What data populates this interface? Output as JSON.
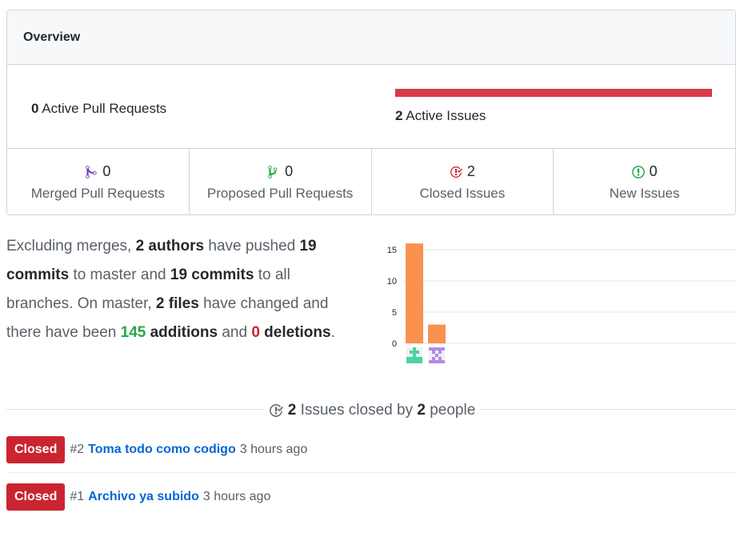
{
  "overview": {
    "title": "Overview"
  },
  "summary": {
    "pull_requests_count": "0",
    "pull_requests_label": "Active Pull Requests",
    "issues_count": "2",
    "issues_label": "Active Issues",
    "issues_bar_fraction": 1.0,
    "issues_bar_color": "#d73a49"
  },
  "stats": [
    {
      "icon": "git-merge-icon",
      "count": "0",
      "label": "Merged Pull Requests",
      "color": "#6f42c1"
    },
    {
      "icon": "git-pull-request-icon",
      "count": "0",
      "label": "Proposed Pull Requests",
      "color": "#28a745"
    },
    {
      "icon": "issue-closed-icon",
      "count": "2",
      "label": "Closed Issues",
      "color": "#cb2431"
    },
    {
      "icon": "issue-opened-icon",
      "count": "0",
      "label": "New Issues",
      "color": "#28a745"
    }
  ],
  "commits_summary": {
    "t1": "Excluding merges, ",
    "authors": "2 authors",
    "t2": " have pushed ",
    "commits_master": "19 commits",
    "t3": " to master and ",
    "commits_all": "19 commits",
    "t4": " to all branches. On master, ",
    "files": "2 files",
    "t5": " have changed and there have been ",
    "additions_num": "145",
    "additions_word": " additions",
    "t6": " and ",
    "deletions_num": "0",
    "deletions_word": " deletions",
    "t7": "."
  },
  "chart_data": {
    "type": "bar",
    "categories": [
      "author-1",
      "author-2"
    ],
    "values": [
      16,
      3
    ],
    "ylim": [
      0,
      15
    ],
    "yticks": [
      0,
      5,
      10,
      15
    ],
    "bar_color": "#f9914f",
    "grid": true,
    "avatar_colors": [
      "#4fd1a5",
      "#b38be6"
    ]
  },
  "closed_section": {
    "count": "2",
    "text1": " Issues closed by ",
    "people": "2",
    "text2": " people"
  },
  "issues": [
    {
      "state": "Closed",
      "number": "#2",
      "title": "Toma todo como codigo",
      "time": "3 hours ago"
    },
    {
      "state": "Closed",
      "number": "#1",
      "title": "Archivo ya subido",
      "time": "3 hours ago"
    }
  ]
}
